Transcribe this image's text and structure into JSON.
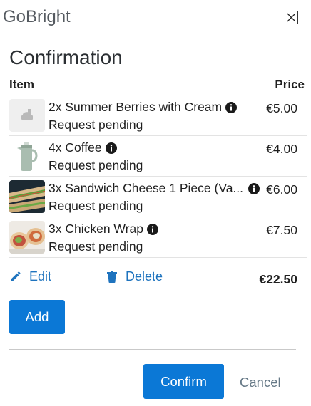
{
  "app": {
    "title": "GoBright",
    "close_label": "X"
  },
  "dialog": {
    "title": "Confirmation"
  },
  "table": {
    "headers": {
      "item": "Item",
      "price": "Price"
    },
    "rows": [
      {
        "name": "2x Summer Berries with Cream",
        "status": "Request pending",
        "price": "€5.00",
        "thumb": "placeholder-food-icon"
      },
      {
        "name": "4x Coffee",
        "status": "Request pending",
        "price": "€4.00",
        "thumb": "coffee-pot-photo"
      },
      {
        "name": "3x Sandwich Cheese 1 Piece (Va...",
        "status": "Request pending",
        "price": "€6.00",
        "thumb": "sandwich-photo"
      },
      {
        "name": "3x Chicken Wrap",
        "status": "Request pending",
        "price": "€7.50",
        "thumb": "chicken-wrap-photo"
      }
    ]
  },
  "actions": {
    "edit_label": "Edit",
    "delete_label": "Delete",
    "total": "€22.50"
  },
  "buttons": {
    "add": "Add",
    "confirm": "Confirm",
    "cancel": "Cancel"
  },
  "colors": {
    "primary": "#0b78d6",
    "link": "#1e73be",
    "muted_link": "#657886"
  }
}
